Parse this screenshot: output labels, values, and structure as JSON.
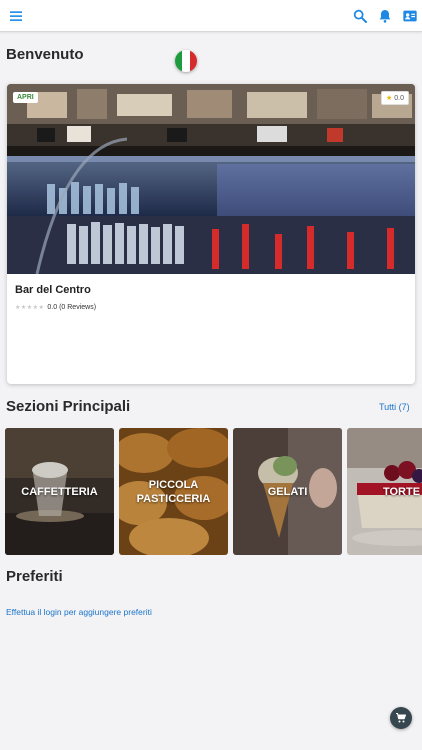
{
  "header": {
    "icons": [
      "menu-icon",
      "search-icon",
      "bell-icon",
      "contact-card-icon"
    ],
    "accent": "#1e88e5"
  },
  "welcome": {
    "title": "Benvenuto",
    "flag": "italy-flag-icon"
  },
  "place": {
    "status_badge": "APRI",
    "rating_badge": "0.0",
    "name": "Bar del Centro",
    "stars": "★★★★★",
    "rating_text": "0.0 (0 Reviews)"
  },
  "sections": {
    "title": "Sezioni Principali",
    "all_link": "Tutti (7)",
    "items": [
      {
        "label": "CAFFETTERIA"
      },
      {
        "label": "PICCOLA PASTICCERIA"
      },
      {
        "label": "GELATI"
      },
      {
        "label": "TORTE"
      }
    ]
  },
  "favorites": {
    "title": "Preferiti",
    "login_prompt": "Effettua il login per aggiungere preferiti"
  },
  "fab": {
    "icon": "cart-icon",
    "color": "#37474f"
  }
}
